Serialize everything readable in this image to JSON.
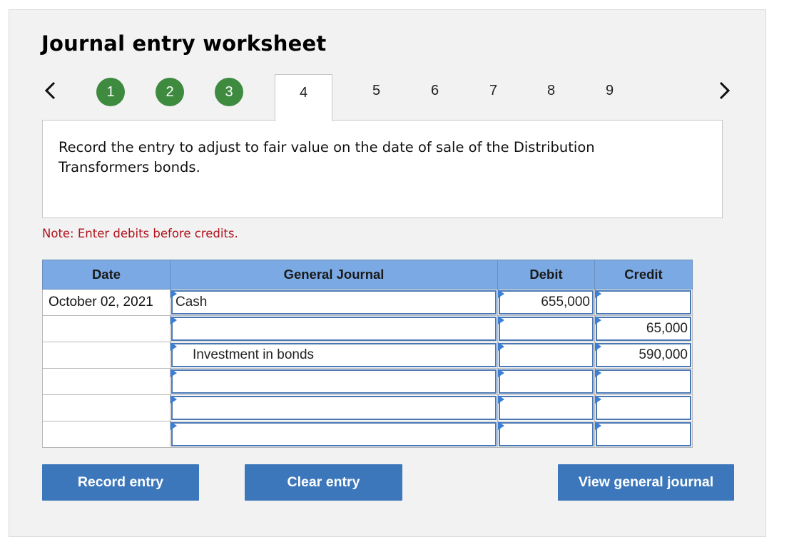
{
  "page": {
    "title": "Journal entry worksheet"
  },
  "steps": {
    "completed": [
      "1",
      "2",
      "3"
    ],
    "current": "4",
    "upcoming": [
      "5",
      "6",
      "7",
      "8",
      "9"
    ]
  },
  "prompt": "Record the entry to adjust to fair value on the date of sale of the Distribution Transformers bonds.",
  "note": "Note: Enter debits before credits.",
  "table": {
    "headers": {
      "date": "Date",
      "journal": "General Journal",
      "debit": "Debit",
      "credit": "Credit"
    },
    "rows": [
      {
        "date": "October 02, 2021",
        "account": "Cash",
        "debit": "655,000",
        "credit": ""
      },
      {
        "date": "",
        "account": "",
        "debit": "",
        "credit": "65,000"
      },
      {
        "date": "",
        "account": "Investment in bonds",
        "debit": "",
        "credit": "590,000"
      },
      {
        "date": "",
        "account": "",
        "debit": "",
        "credit": ""
      },
      {
        "date": "",
        "account": "",
        "debit": "",
        "credit": ""
      },
      {
        "date": "",
        "account": "",
        "debit": "",
        "credit": ""
      }
    ]
  },
  "buttons": {
    "record": "Record entry",
    "clear": "Clear entry",
    "view": "View general journal"
  },
  "colors": {
    "step_done": "#3e8b40",
    "header_bg": "#7aa9e3",
    "button_bg": "#3c77bb",
    "note_text": "#b0141d"
  },
  "icons": {
    "prev": "chevron-left-icon",
    "next": "chevron-right-icon"
  }
}
